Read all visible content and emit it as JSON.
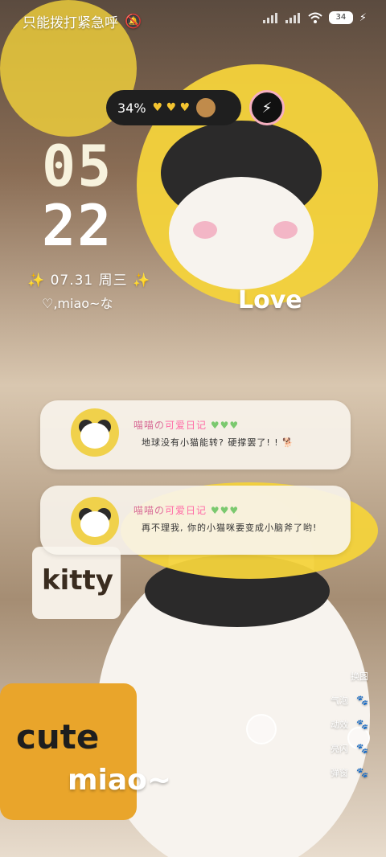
{
  "status_bar": {
    "carrier_text": "只能拨打紧急呼",
    "battery": "34"
  },
  "widget": {
    "battery_pct": "34%",
    "hearts": "♥ ♥ ♥",
    "bolt_icon": "⚡"
  },
  "clock": {
    "hour": "05",
    "minute": "22"
  },
  "date": {
    "text": "07.31 周三"
  },
  "signature": {
    "text": "♡,miao~な"
  },
  "wallpaper_text": {
    "love": "Love",
    "kitty": "kitty",
    "cute": "cute",
    "miao": "miao~"
  },
  "notifications": [
    {
      "title_prefix": "喵喵の",
      "title_highlight": "可爱日记",
      "hearts": "♥♥♥",
      "body": "地球没有小猫能转? 硬撑罢了! ! 🐕"
    },
    {
      "title_prefix": "喵喵の",
      "title_highlight": "可爱日记",
      "hearts": "♥♥♥",
      "body": "再不理我, 你的小猫咪要变成小脑斧了哟!"
    }
  ],
  "quick_menu": [
    {
      "label": "换图"
    },
    {
      "label": "气泡"
    },
    {
      "label": "动效"
    },
    {
      "label": "亮闪"
    },
    {
      "label": "弹窗"
    }
  ]
}
